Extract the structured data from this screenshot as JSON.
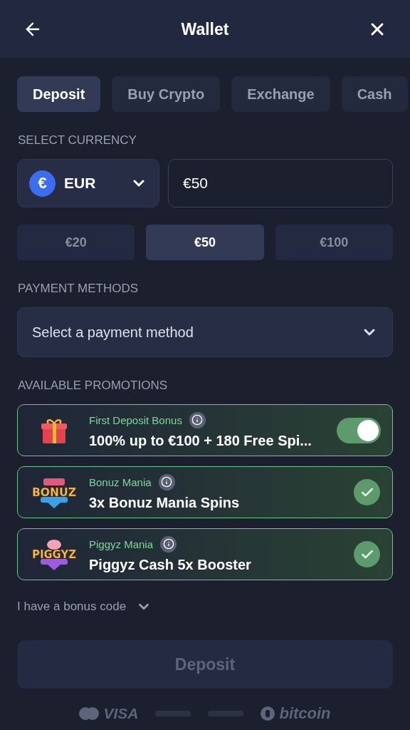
{
  "header": {
    "title": "Wallet"
  },
  "tabs": [
    {
      "label": "Deposit",
      "selected": true
    },
    {
      "label": "Buy Crypto",
      "selected": false
    },
    {
      "label": "Exchange",
      "selected": false
    },
    {
      "label": "Cash",
      "selected": false
    }
  ],
  "currency": {
    "label": "SELECT CURRENCY",
    "code": "EUR",
    "symbol": "€",
    "amount": "€50"
  },
  "amount_chips": [
    {
      "label": "€20",
      "selected": false
    },
    {
      "label": "€50",
      "selected": true
    },
    {
      "label": "€100",
      "selected": false
    }
  ],
  "payment": {
    "label": "PAYMENT METHODS",
    "placeholder": "Select a payment method"
  },
  "promotions": {
    "label": "AVAILABLE PROMOTIONS",
    "items": [
      {
        "kind": "toggle",
        "name": "First Deposit Bonus",
        "title": "100% up to €100 + 180 Free Spi...",
        "on": true
      },
      {
        "kind": "check",
        "logo_text": "BONUZ",
        "name": "Bonuz Mania",
        "title": "3x Bonuz Mania Spins",
        "checked": true
      },
      {
        "kind": "check",
        "logo_text": "PIGGYZ",
        "name": "Piggyz Mania",
        "title": "Piggyz Cash 5x Booster",
        "checked": true
      }
    ]
  },
  "bonus_code": {
    "label": "I have a bonus code",
    "expanded": false
  },
  "deposit_button": {
    "label": "Deposit",
    "disabled": true
  },
  "payment_logos": [
    {
      "kind": "cards",
      "text": "VISA"
    },
    {
      "kind": "faint"
    },
    {
      "kind": "faint"
    },
    {
      "kind": "bitcoin",
      "text": "bitcoin"
    }
  ]
}
